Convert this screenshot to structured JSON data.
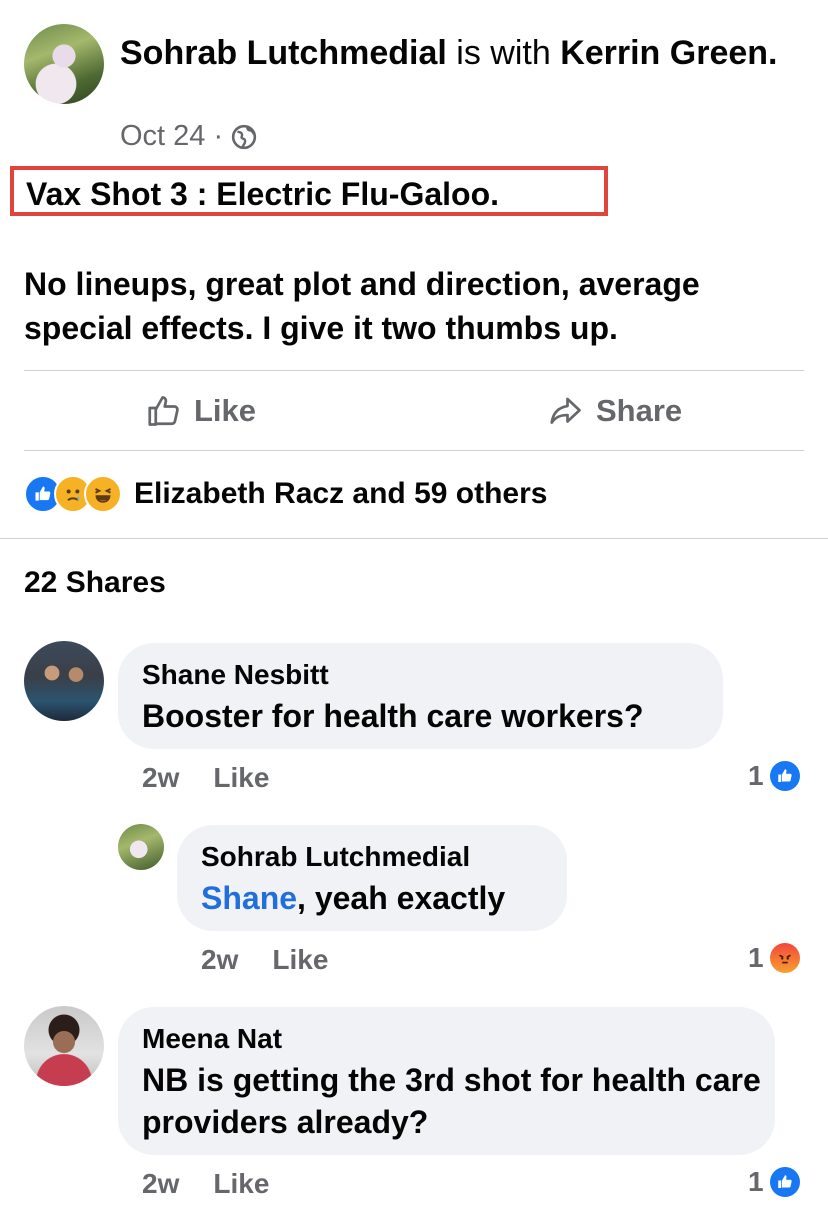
{
  "post": {
    "author": "Sohrab Lutchmedial",
    "with_text": " is with ",
    "tagged": "Kerrin Green",
    "tagged_suffix": ".",
    "date": "Oct 24",
    "separator": "·",
    "privacy_icon": "globe-icon",
    "title": "Vax Shot 3 : Electric Flu-Galoo.",
    "body": "No lineups, great plot and direction, average special effects. I give it two thumbs up."
  },
  "actions": {
    "like_label": "Like",
    "share_label": "Share"
  },
  "reactions": {
    "icons": [
      "like-reaction-icon",
      "sad-reaction-icon",
      "haha-reaction-icon"
    ],
    "summary": "Elizabeth Racz and 59 others"
  },
  "shares": {
    "label": "22 Shares"
  },
  "comments": [
    {
      "name": "Shane Nesbitt",
      "text": "Booster for health care workers?",
      "time": "2w",
      "like_label": "Like",
      "reaction_count": "1",
      "reaction_icon": "like-reaction-icon"
    },
    {
      "name": "Sohrab Lutchmedial",
      "mention": "Shane",
      "text": ", yeah exactly",
      "time": "2w",
      "like_label": "Like",
      "reaction_count": "1",
      "reaction_icon": "angry-reaction-icon"
    },
    {
      "name": "Meena Nat",
      "text": "NB is getting the 3rd shot for health care providers already?",
      "time": "2w",
      "like_label": "Like",
      "reaction_count": "1",
      "reaction_icon": "like-reaction-icon"
    }
  ],
  "colors": {
    "highlight_border": "#e0443a",
    "mention": "#216fdb",
    "like_blue": "#1877f2",
    "bubble_bg": "#f0f2f5",
    "meta_gray": "#65676b"
  }
}
